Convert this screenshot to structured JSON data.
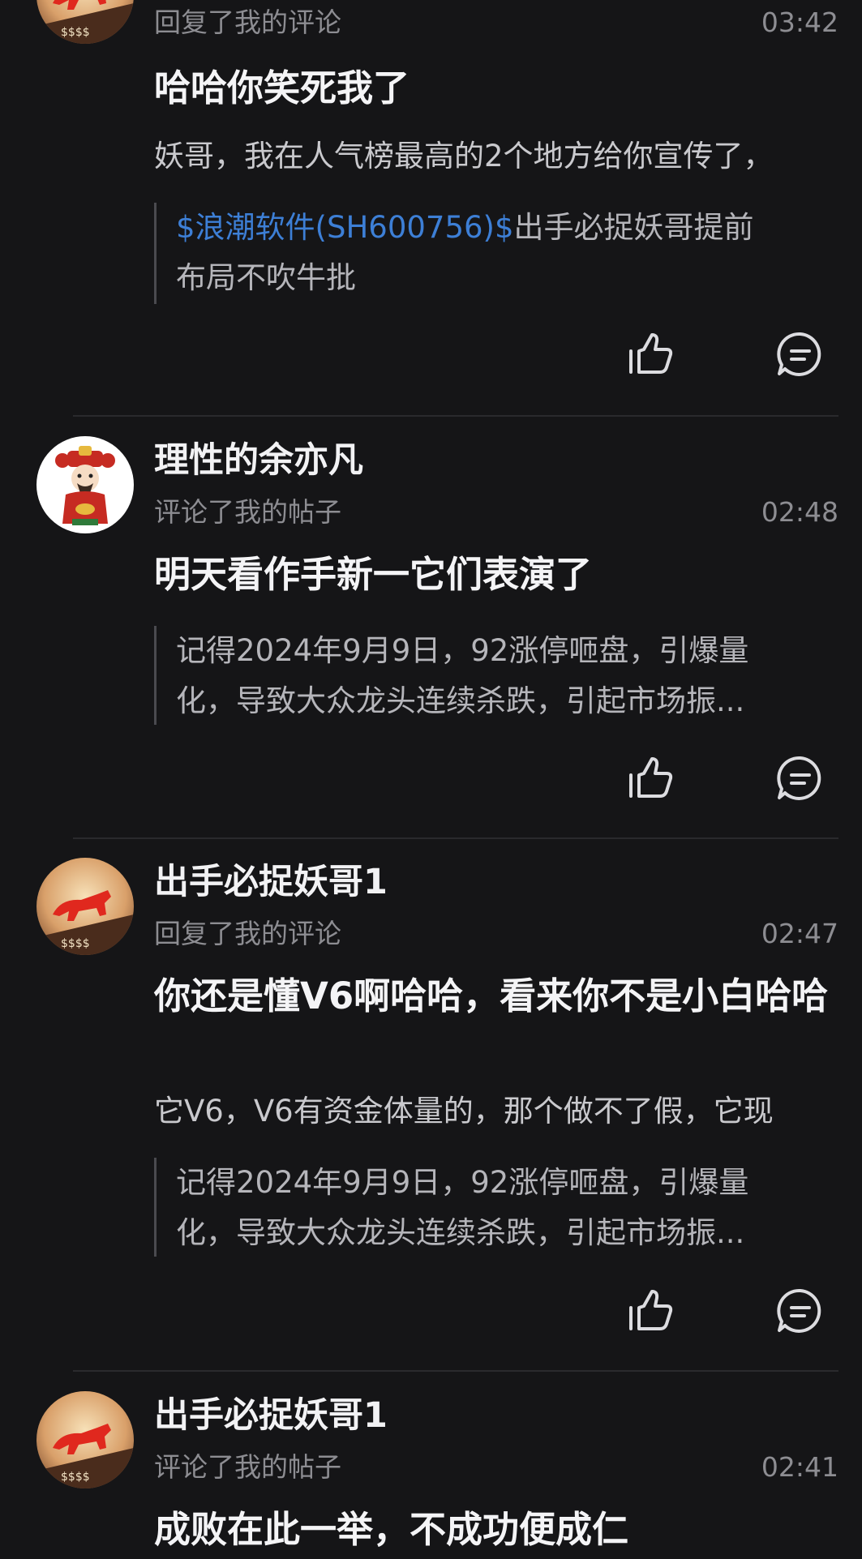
{
  "items": [
    {
      "action": "回复了我的评论",
      "time": "03:42",
      "main": "哈哈你笑死我了",
      "reply": "妖哥，我在人气榜最高的2个地方给你宣传了，",
      "quote_stock": "$浪潮软件(SH600756)$",
      "quote_line1_rest": "出手必捉妖哥提前",
      "quote_line2": "布局不吹牛批",
      "avatar": "bull-avatar"
    },
    {
      "name": "理性的余亦凡",
      "action": "评论了我的帖子",
      "time": "02:48",
      "main": "明天看作手新一它们表演了",
      "quote_line1": "记得2024年9月9日，92涨停咂盘，引爆量",
      "quote_line2": "化，导致大众龙头连续杀跌，引起市场振...",
      "avatar": "fortune-god-avatar"
    },
    {
      "name": "出手必捉妖哥1",
      "action": "回复了我的评论",
      "time": "02:47",
      "main": "你还是懂V6啊哈哈，看来你不是小白哈哈",
      "reply": "它V6，V6有资金体量的，那个做不了假，它现",
      "quote_line1": "记得2024年9月9日，92涨停咂盘，引爆量",
      "quote_line2": "化，导致大众龙头连续杀跌，引起市场振...",
      "avatar": "bull-avatar"
    },
    {
      "name": "出手必捉妖哥1",
      "action": "评论了我的帖子",
      "time": "02:41",
      "main": "成败在此一举，不成功便成仁",
      "avatar": "bull-avatar"
    }
  ],
  "icons": {
    "like": "thumbs-up-icon",
    "comment": "comment-bubble-icon"
  },
  "colors": {
    "background": "#151517",
    "stock_link": "#3d7fd6",
    "muted_text": "#8d8d92"
  }
}
